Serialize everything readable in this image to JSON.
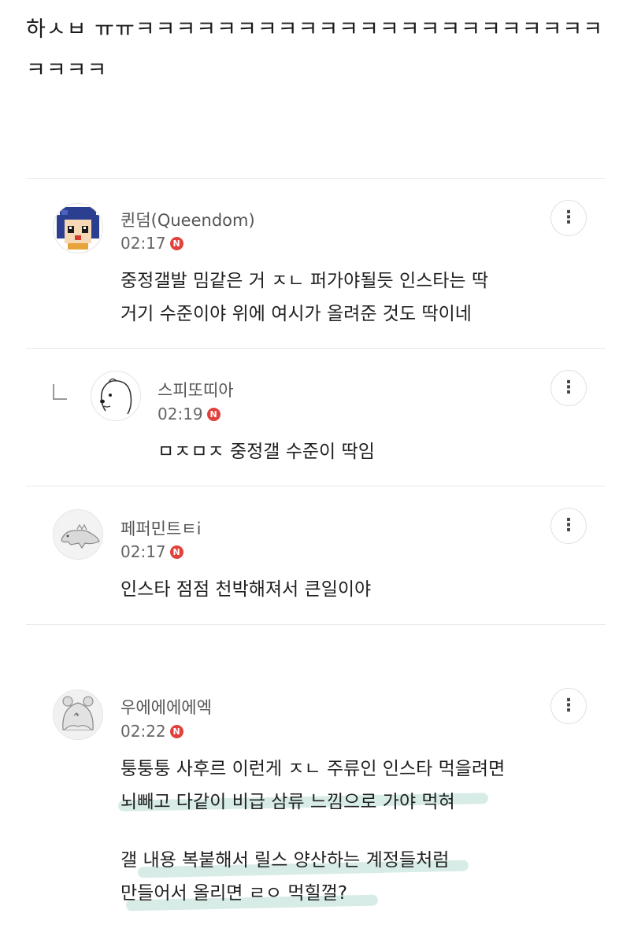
{
  "post": {
    "text": "하ㅅㅂ ㅠㅠㅋㅋㅋㅋㅋㅋㅋㅋㅋㅋㅋㅋㅋㅋㅋㅋㅋㅋㅋㅋㅋㅋㅋㅋㅋㅋㅋ"
  },
  "comments": [
    {
      "author": "퀸덤(Queendom)",
      "time": "02:17",
      "badge": "N",
      "lines": [
        "중정갤발 밈같은 거 ㅈㄴ 퍼가야될듯 인스타는 딱",
        "거기 수준이야 위에 여시가 올려준 것도 딱이네"
      ]
    },
    {
      "author": "스피또띠아",
      "time": "02:19",
      "badge": "N",
      "lines": [
        "ㅁㅈㅁㅈ 중정갤 수준이 딱임"
      ]
    },
    {
      "author": "페퍼민트ㅌi",
      "time": "02:17",
      "badge": "N",
      "lines": [
        "인스타 점점 천박해져서 큰일이야"
      ]
    },
    {
      "author": "우에에에에엑",
      "time": "02:22",
      "badge": "N",
      "lines": [
        "퉁퉁퉁 사후르 이런게 ㅈㄴ 주류인 인스타 먹을려면",
        "뇌빼고 다같이 비급 삼류 느낌으로 가야 먹혀",
        "갤 내용 복붙해서 릴스 양산하는 계정들처럼",
        "만들어서 올리면 ㄹㅇ 먹힐껄?"
      ]
    }
  ],
  "more_icon": "⋮",
  "colors": {
    "badge": "#e0413b",
    "highlight": "#d8ece7",
    "divider": "#e9e9e9"
  }
}
